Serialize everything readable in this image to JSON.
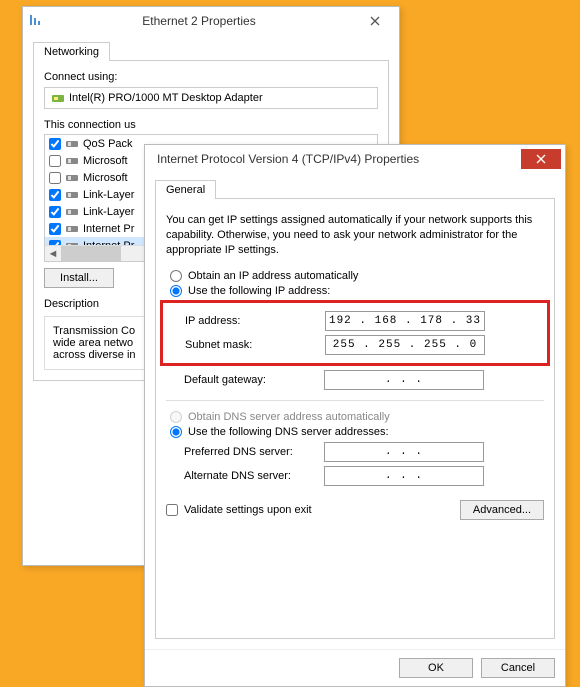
{
  "eth": {
    "title": "Ethernet 2 Properties",
    "tab": "Networking",
    "connect_using": "Connect using:",
    "adapter": "Intel(R) PRO/1000 MT Desktop Adapter",
    "connection_uses": "This connection us",
    "items": [
      {
        "checked": true,
        "label": "QoS Pack"
      },
      {
        "checked": false,
        "label": "Microsoft"
      },
      {
        "checked": false,
        "label": "Microsoft"
      },
      {
        "checked": true,
        "label": "Link-Layer"
      },
      {
        "checked": true,
        "label": "Link-Layer"
      },
      {
        "checked": true,
        "label": "Internet Pr"
      },
      {
        "checked": true,
        "label": "Internet Pr"
      }
    ],
    "install": "Install...",
    "description_label": "Description",
    "description": "Transmission Co\nwide area netwo\nacross diverse in"
  },
  "ipv4": {
    "title": "Internet Protocol Version 4 (TCP/IPv4) Properties",
    "tab": "General",
    "help": "You can get IP settings assigned automatically if your network supports this capability. Otherwise, you need to ask your network administrator for the appropriate IP settings.",
    "opt_auto_ip": "Obtain an IP address automatically",
    "opt_manual_ip": "Use the following IP address:",
    "ip_label": "IP address:",
    "ip_value": "192 . 168 . 178 .  33",
    "subnet_label": "Subnet mask:",
    "subnet_value": "255 . 255 . 255 .   0",
    "gateway_label": "Default gateway:",
    "gateway_value": ".       .       .",
    "opt_auto_dns": "Obtain DNS server address automatically",
    "opt_manual_dns": "Use the following DNS server addresses:",
    "pref_dns_label": "Preferred DNS server:",
    "pref_dns_value": ".       .       .",
    "alt_dns_label": "Alternate DNS server:",
    "alt_dns_value": ".       .       .",
    "validate": "Validate settings upon exit",
    "advanced": "Advanced...",
    "ok": "OK",
    "cancel": "Cancel"
  }
}
